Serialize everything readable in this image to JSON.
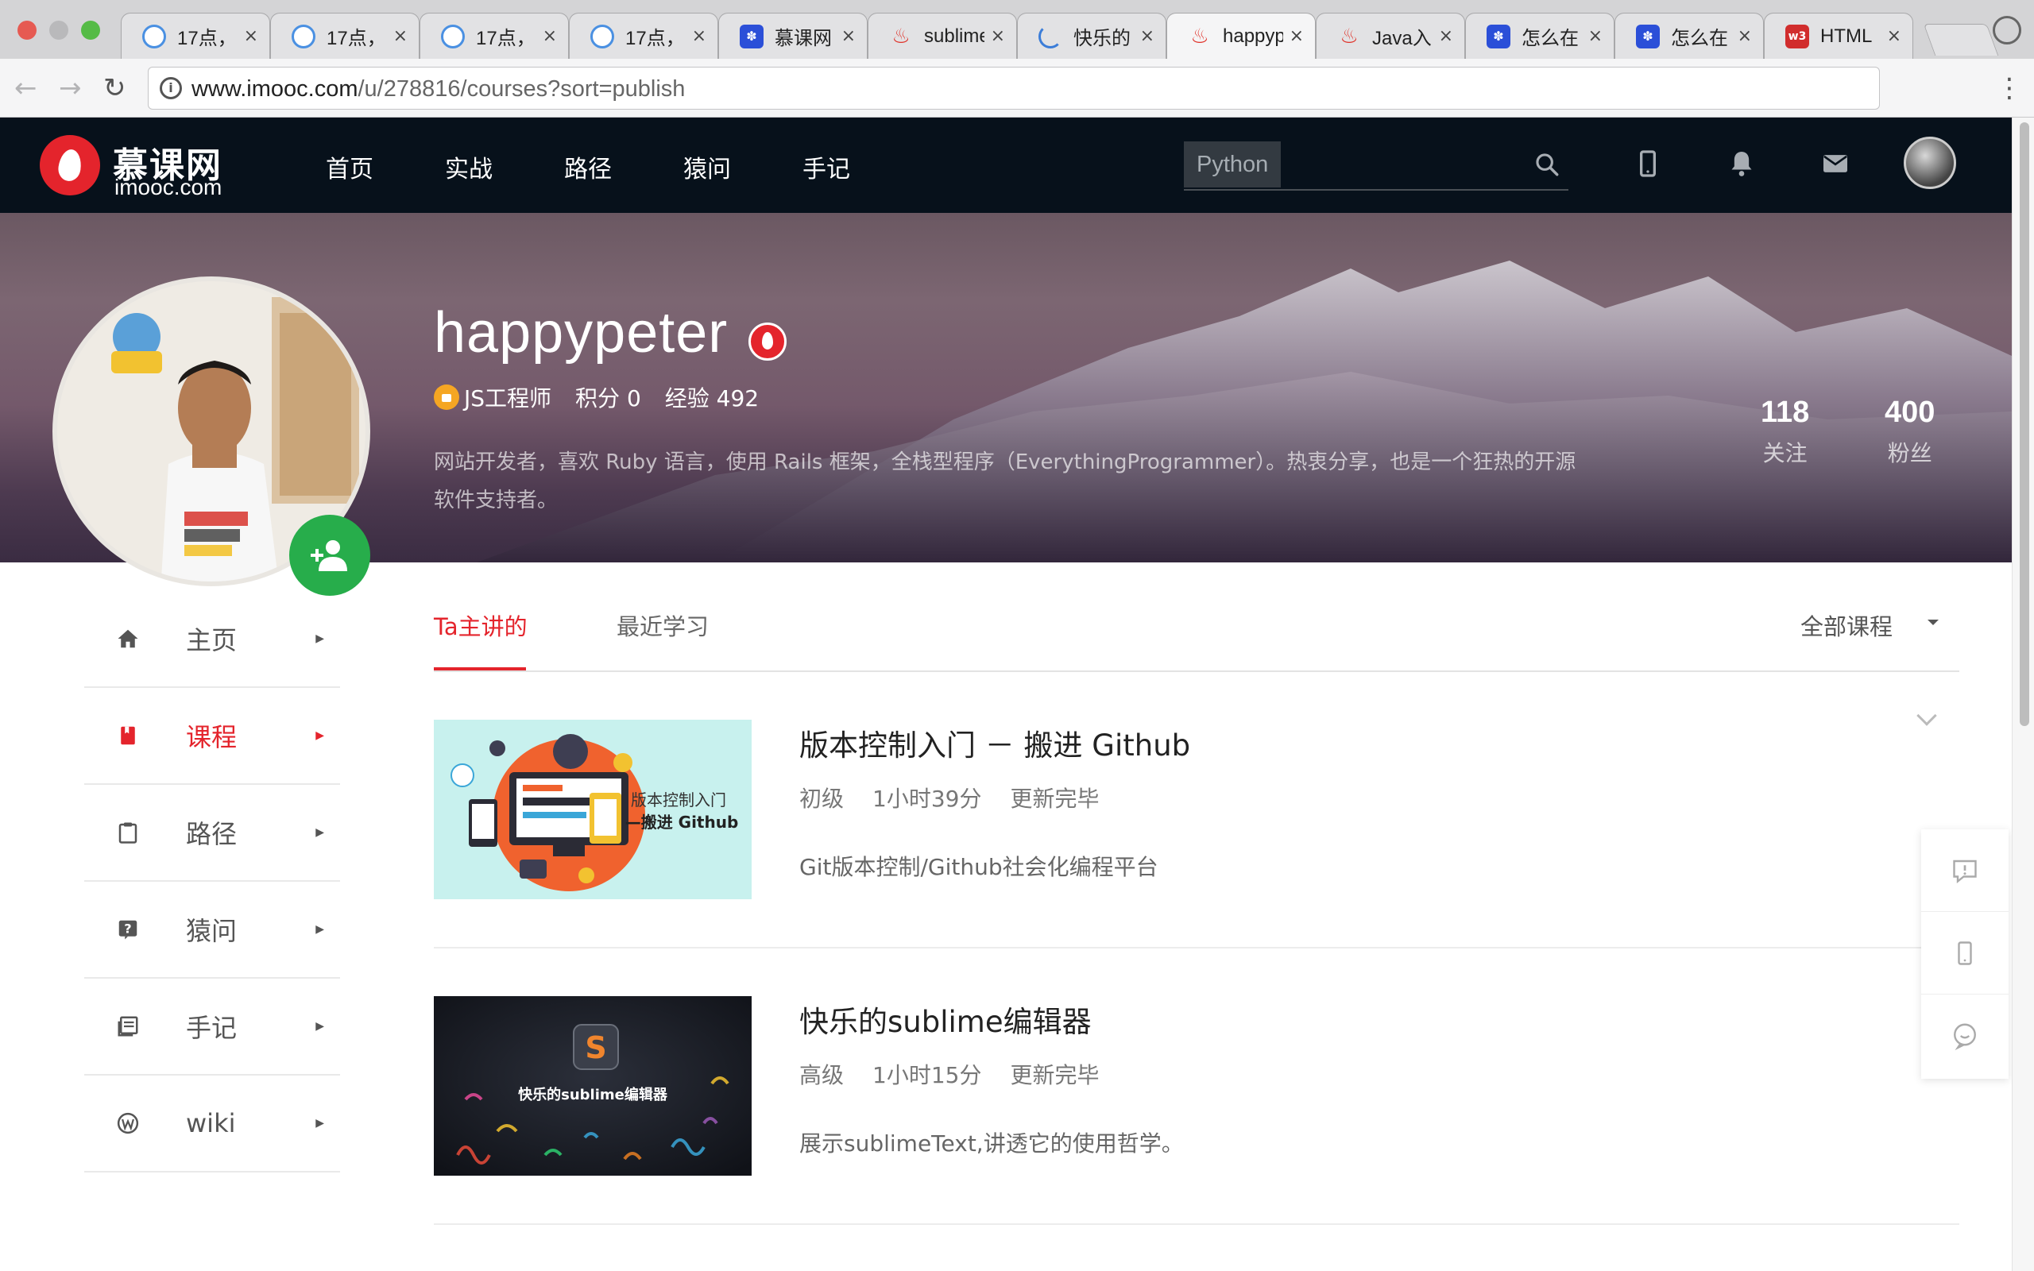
{
  "browser": {
    "tabs": [
      {
        "title": "17点，",
        "icon": "clock-icon"
      },
      {
        "title": "17点，",
        "icon": "clock-icon"
      },
      {
        "title": "17点，",
        "icon": "clock-icon"
      },
      {
        "title": "17点，",
        "icon": "clock-icon"
      },
      {
        "title": "慕课网",
        "icon": "paw-icon"
      },
      {
        "title": "sublime",
        "icon": "flame-icon"
      },
      {
        "title": "快乐的",
        "icon": "loading-icon"
      },
      {
        "title": "happyp",
        "icon": "flame-icon"
      },
      {
        "title": "Java入",
        "icon": "flame-icon"
      },
      {
        "title": "怎么在",
        "icon": "paw-icon"
      },
      {
        "title": "怎么在",
        "icon": "paw-icon"
      },
      {
        "title": "HTML",
        "icon": "w3-icon"
      }
    ],
    "tab_close_glyph": "×",
    "w3_label": "w3",
    "url_host": "www.imooc.com",
    "url_path": "/u/278816/courses?sort=publish"
  },
  "header": {
    "logo_cn": "慕课网",
    "logo_en": "imooc.com",
    "nav": [
      "首页",
      "实战",
      "路径",
      "猿问",
      "手记"
    ],
    "search_tag": "Python"
  },
  "profile": {
    "username": "happypeter",
    "title": "JS工程师",
    "points": "积分 0",
    "experience": "经验 492",
    "bio": "网站开发者，喜欢 Ruby 语言，使用 Rails 框架，全栈型程序（EverythingProgrammer）。热衷分享，也是一个狂热的开源软件支持者。",
    "following_count": "118",
    "following_label": "关注",
    "fans_count": "400",
    "fans_label": "粉丝"
  },
  "sidebar": {
    "items": [
      {
        "label": "主页",
        "icon": "home-icon"
      },
      {
        "label": "课程",
        "icon": "book-icon",
        "active": true
      },
      {
        "label": "路径",
        "icon": "clipboard-icon"
      },
      {
        "label": "猿问",
        "icon": "question-icon"
      },
      {
        "label": "手记",
        "icon": "notes-icon"
      },
      {
        "label": "wiki",
        "icon": "wiki-icon"
      }
    ]
  },
  "course_tabs": {
    "tab1": "Ta主讲的",
    "tab2": "最近学习",
    "filter": "全部课程"
  },
  "courses": [
    {
      "title": "版本控制入门 － 搬进 Github",
      "level": "初级",
      "duration": "1小时39分",
      "status": "更新完毕",
      "desc": "Git版本控制/Github社会化编程平台",
      "thumb_line1": "版本控制入门",
      "thumb_line2": "—搬进 Github"
    },
    {
      "title": "快乐的sublime编辑器",
      "level": "高级",
      "duration": "1小时15分",
      "status": "更新完毕",
      "desc": "展示sublimeText,讲透它的使用哲学。",
      "thumb_text": "快乐的sublime编辑器",
      "thumb_logo": "S"
    }
  ],
  "colors": {
    "brand_red": "#e4242c",
    "follow_green": "#27ad4b",
    "header_bg": "#07111b"
  }
}
